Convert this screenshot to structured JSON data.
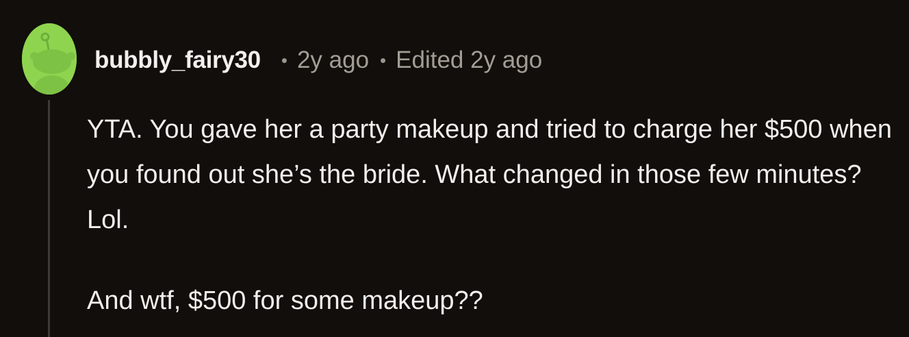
{
  "comment": {
    "username": "bubbly_fairy30",
    "separator": "•",
    "timestamp": "2y ago",
    "edited": "Edited 2y ago",
    "paragraphs": [
      "YTA. You gave her a party makeup and tried to charge her $500 when you found out she’s the bride. What changed in those few minutes? Lol.",
      "And wtf, $500 for some makeup??"
    ],
    "avatar_icon": "snoo-avatar-icon"
  },
  "colors": {
    "background": "#110e0b",
    "avatar_background": "#8fd44f",
    "text": "#f2efec",
    "meta_text": "#a49d95",
    "thread_line": "#3e3a36"
  }
}
